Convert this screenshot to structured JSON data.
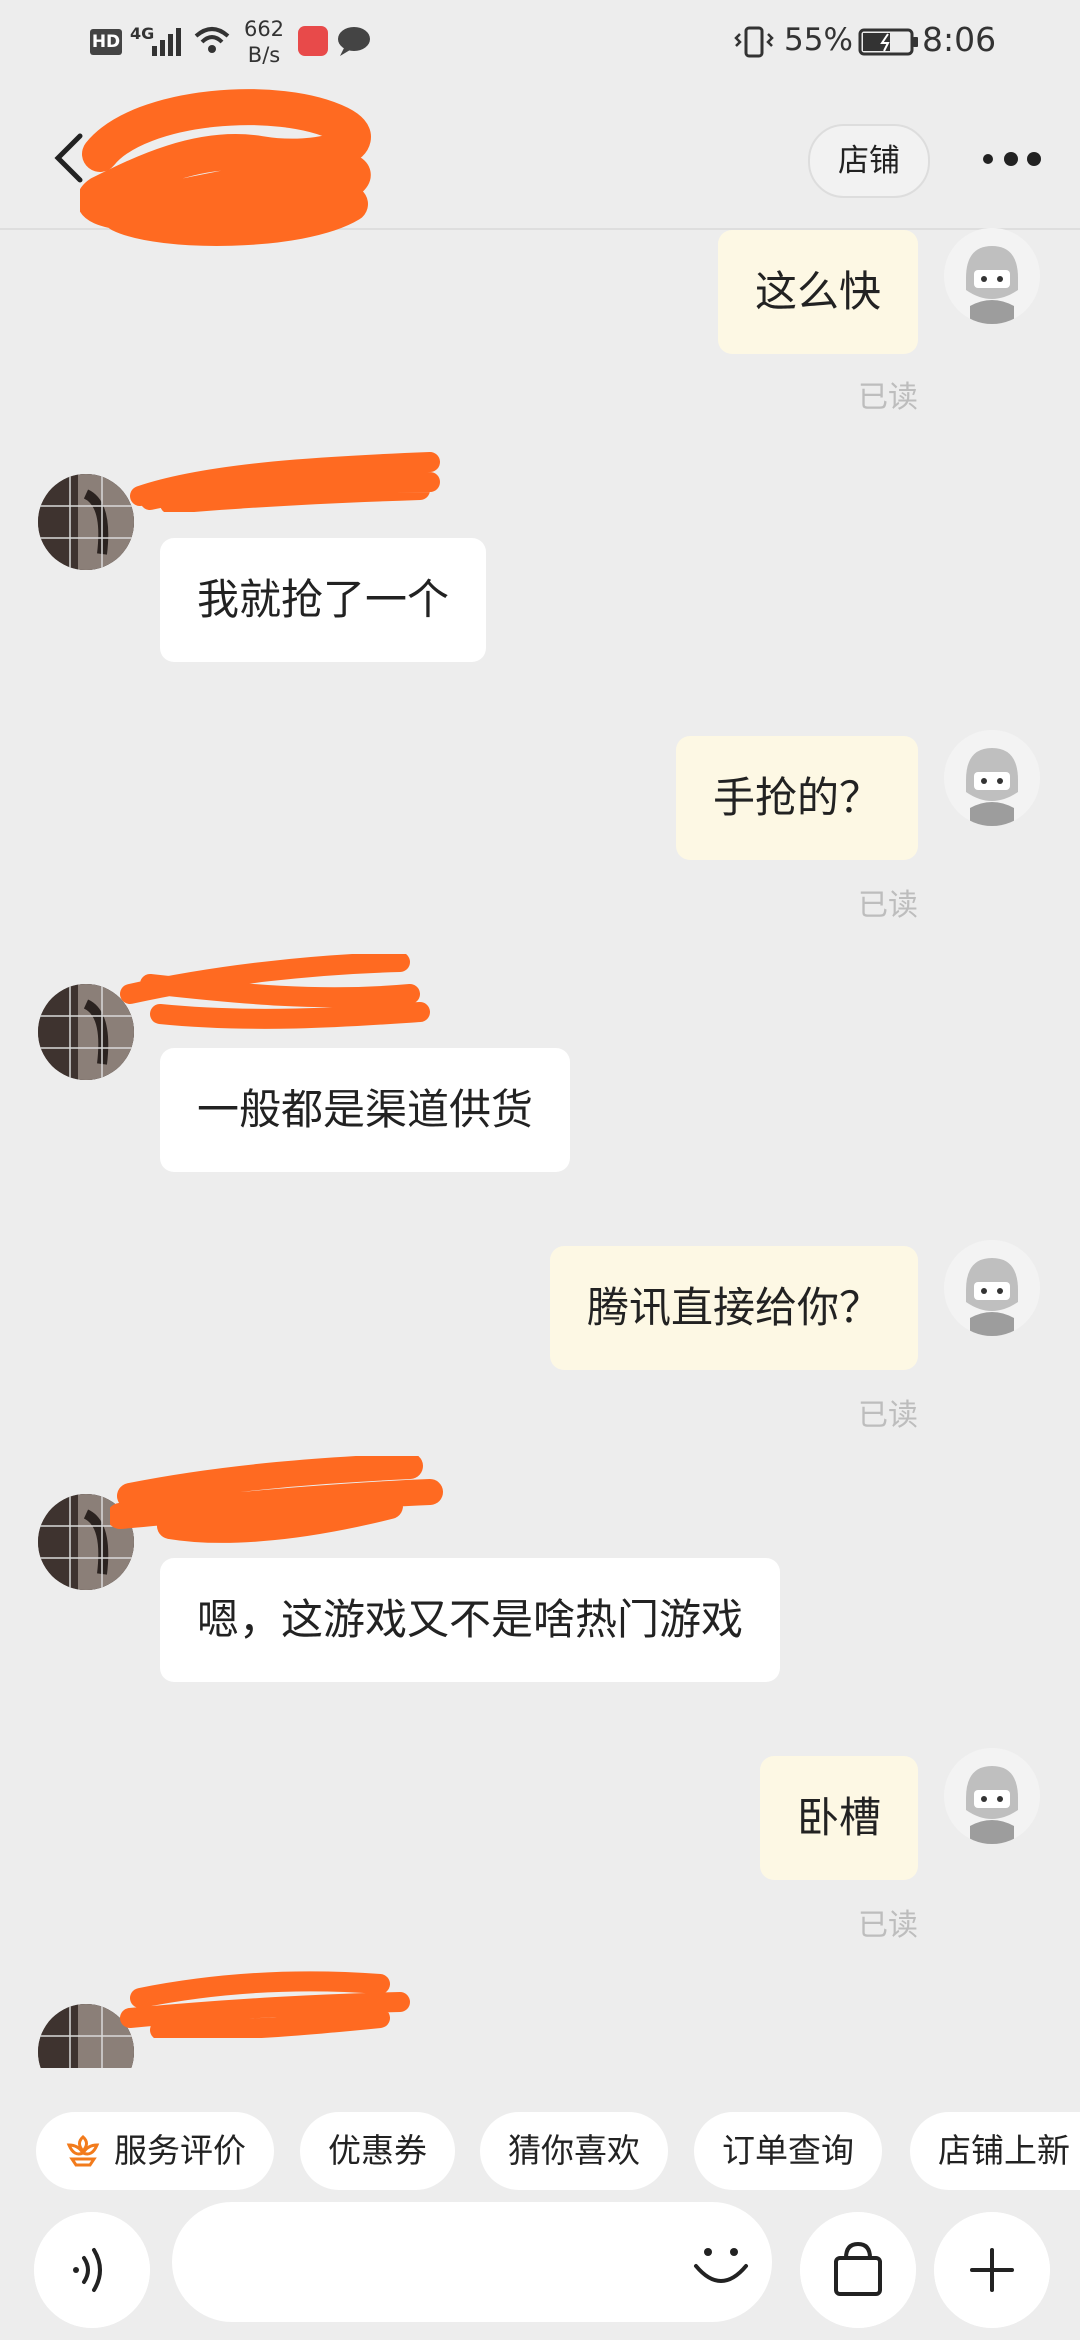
{
  "status_bar": {
    "hd": "HD",
    "network": "4G",
    "speed_value": "662",
    "speed_unit": "B/s",
    "battery_percent": "55%",
    "time": "8:06"
  },
  "header": {
    "store_label": "店铺"
  },
  "messages": [
    {
      "side": "out",
      "text": "这么快",
      "status": "已读"
    },
    {
      "side": "in",
      "text": "我就抢了一个"
    },
    {
      "side": "out",
      "text": "手抢的？",
      "status": "已读"
    },
    {
      "side": "in",
      "text": "一般都是渠道供货"
    },
    {
      "side": "out",
      "text": "腾讯直接给你？",
      "status": "已读"
    },
    {
      "side": "in",
      "text": "嗯，这游戏又不是啥热门游戏"
    },
    {
      "side": "out",
      "text": "卧槽",
      "status": "已读"
    }
  ],
  "quick_actions": [
    {
      "label": "服务评价",
      "icon": "flower-icon"
    },
    {
      "label": "优惠券"
    },
    {
      "label": "猜你喜欢"
    },
    {
      "label": "订单查询"
    },
    {
      "label": "店铺上新"
    }
  ],
  "input": {
    "value": ""
  },
  "colors": {
    "background": "#ededed",
    "outgoing_bubble": "#fdf8e4",
    "incoming_bubble": "#ffffff",
    "redaction": "#ff6a21",
    "accent_orange": "#f27b1c"
  }
}
